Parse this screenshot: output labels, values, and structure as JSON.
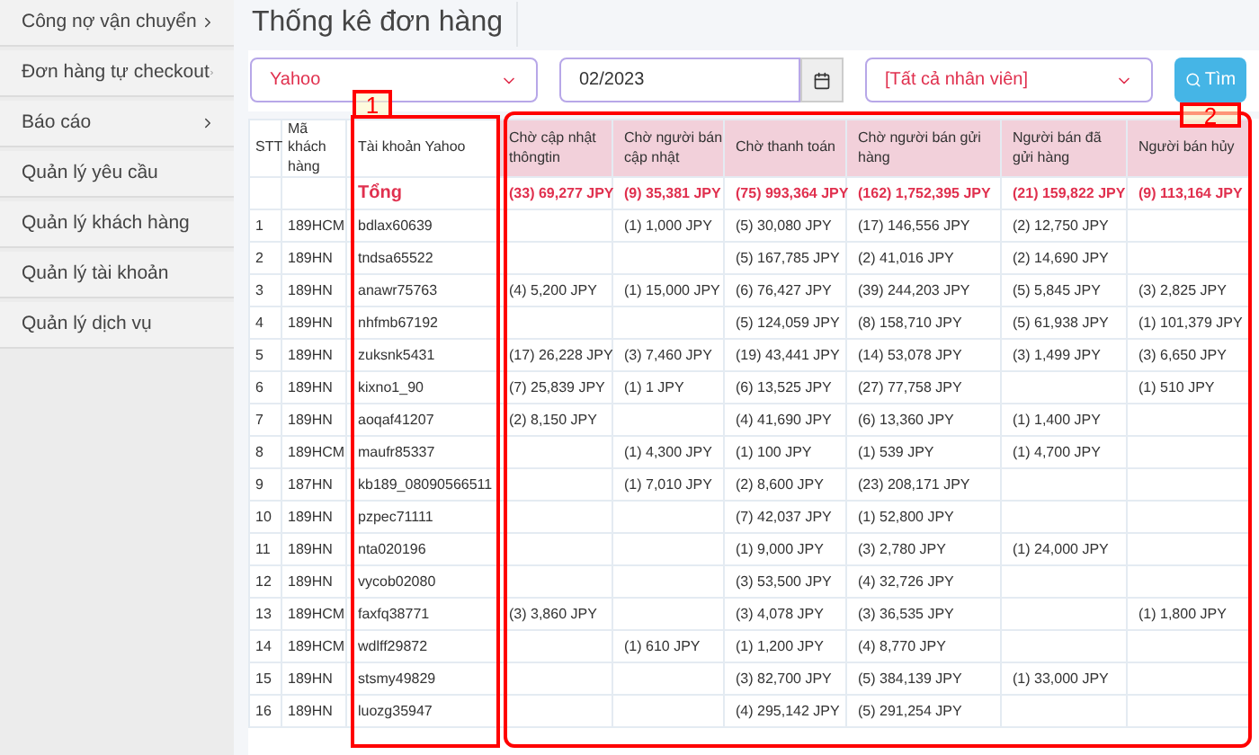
{
  "sidebar": {
    "items": [
      {
        "label": "Công nợ vận chuyển",
        "has_submenu": true
      },
      {
        "label": "Đơn hàng tự checkout",
        "has_submenu": true
      },
      {
        "label": "Báo cáo",
        "has_submenu": true
      },
      {
        "label": "Quản lý yêu cầu",
        "has_submenu": false
      },
      {
        "label": "Quản lý khách hàng",
        "has_submenu": false
      },
      {
        "label": "Quản lý tài khoản",
        "has_submenu": false
      },
      {
        "label": "Quản lý dịch vụ",
        "has_submenu": false
      }
    ]
  },
  "page_title": "Thống kê đơn hàng",
  "filters": {
    "site_select": "Yahoo",
    "month_field": "02/2023",
    "staff_select": "[Tất cả nhân viên]",
    "search_button": "Tìm"
  },
  "table": {
    "columns": [
      "STT",
      "Mã khách hàng",
      "Tài khoản Yahoo",
      "Chờ cập nhật thôngtin",
      "Chờ người bán cập nhật",
      "Chờ thanh toán",
      "Chờ người bán gửi hàng",
      "Người bán đã gửi hàng",
      "Người bán hủy"
    ],
    "rows": [
      {
        "kind": "total",
        "cells": [
          "",
          "",
          "Tổng",
          "(33) 69,277 JPY",
          "(9) 35,381 JPY",
          "(75) 993,364 JPY",
          "(162) 1,752,395 JPY",
          "(21) 159,822 JPY",
          "(9) 113,164 JPY"
        ]
      },
      {
        "kind": "data",
        "cells": [
          "1",
          "189HCM",
          "bdlax60639",
          "",
          "(1) 1,000 JPY",
          "(5) 30,080 JPY",
          "(17) 146,556 JPY",
          "(2) 12,750 JPY",
          ""
        ]
      },
      {
        "kind": "data",
        "cells": [
          "2",
          "189HN",
          "tndsa65522",
          "",
          "",
          "(5) 167,785 JPY",
          "(2) 41,016 JPY",
          "(2) 14,690 JPY",
          ""
        ]
      },
      {
        "kind": "data",
        "cells": [
          "3",
          "189HN",
          "anawr75763",
          "(4) 5,200 JPY",
          "(1) 15,000 JPY",
          "(6) 76,427 JPY",
          "(39) 244,203 JPY",
          "(5) 5,845 JPY",
          "(3) 2,825 JPY"
        ]
      },
      {
        "kind": "data",
        "cells": [
          "4",
          "189HN",
          "nhfmb67192",
          "",
          "",
          "(5) 124,059 JPY",
          "(8) 158,710 JPY",
          "(5) 61,938 JPY",
          "(1) 101,379 JPY"
        ]
      },
      {
        "kind": "data",
        "cells": [
          "5",
          "189HN",
          "zuksnk5431",
          "(17) 26,228 JPY",
          "(3) 7,460 JPY",
          "(19) 43,441 JPY",
          "(14) 53,078 JPY",
          "(3) 1,499 JPY",
          "(3) 6,650 JPY"
        ]
      },
      {
        "kind": "data",
        "cells": [
          "6",
          "189HN",
          "kixno1_90",
          "(7) 25,839 JPY",
          "(1) 1 JPY",
          "(6) 13,525 JPY",
          "(27) 77,758 JPY",
          "",
          "(1) 510 JPY"
        ]
      },
      {
        "kind": "data",
        "cells": [
          "7",
          "189HN",
          "aoqaf41207",
          "(2) 8,150 JPY",
          "",
          "(4) 41,690 JPY",
          "(6) 13,360 JPY",
          "(1) 1,400 JPY",
          ""
        ]
      },
      {
        "kind": "data",
        "cells": [
          "8",
          "189HCM",
          "maufr85337",
          "",
          "(1) 4,300 JPY",
          "(1) 100 JPY",
          "(1) 539 JPY",
          "(1) 4,700 JPY",
          ""
        ]
      },
      {
        "kind": "data",
        "cells": [
          "9",
          "187HN",
          "kb189_08090566511",
          "",
          "(1) 7,010 JPY",
          "(2) 8,600 JPY",
          "(23) 208,171 JPY",
          "",
          ""
        ]
      },
      {
        "kind": "data",
        "cells": [
          "10",
          "189HN",
          "pzpec71111",
          "",
          "",
          "(7) 42,037 JPY",
          "(1) 52,800 JPY",
          "",
          ""
        ]
      },
      {
        "kind": "data",
        "cells": [
          "11",
          "189HN",
          "nta020196",
          "",
          "",
          "(1) 9,000 JPY",
          "(3) 2,780 JPY",
          "(1) 24,000 JPY",
          ""
        ]
      },
      {
        "kind": "data",
        "cells": [
          "12",
          "189HN",
          "vycob02080",
          "",
          "",
          "(3) 53,500 JPY",
          "(4) 32,726 JPY",
          "",
          ""
        ]
      },
      {
        "kind": "data",
        "cells": [
          "13",
          "189HCM",
          "faxfq38771",
          "(3) 3,860 JPY",
          "",
          "(3) 4,078 JPY",
          "(3) 36,535 JPY",
          "",
          "(1) 1,800 JPY"
        ]
      },
      {
        "kind": "data",
        "cells": [
          "14",
          "189HCM",
          "wdlff29872",
          "",
          "(1) 610 JPY",
          "(1) 1,200 JPY",
          "(4) 8,770 JPY",
          "",
          ""
        ]
      },
      {
        "kind": "data",
        "cells": [
          "15",
          "189HN",
          "stsmy49829",
          "",
          "",
          "(3) 82,700 JPY",
          "(5) 384,139 JPY",
          "(1) 33,000 JPY",
          ""
        ]
      },
      {
        "kind": "data",
        "cells": [
          "16",
          "189HN",
          "luozg35947",
          "",
          "",
          "(4) 295,142 JPY",
          "(5) 291,254 JPY",
          "",
          ""
        ]
      }
    ]
  },
  "annotations": [
    {
      "label": "1"
    },
    {
      "label": "2"
    }
  ]
}
